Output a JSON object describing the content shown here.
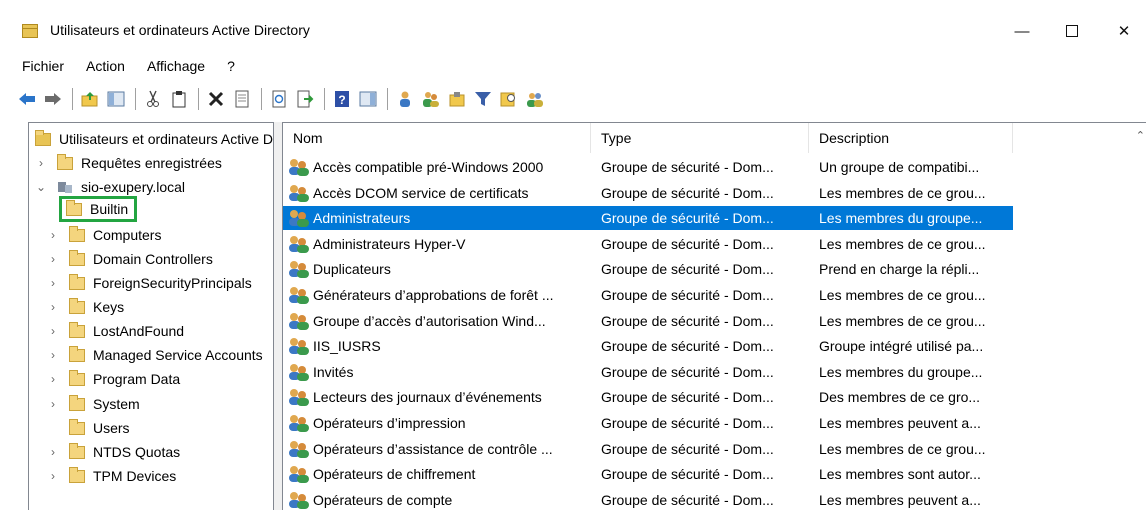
{
  "window": {
    "title": "Utilisateurs et ordinateurs Active Directory",
    "minimize_glyph": "—",
    "close_glyph": "✕"
  },
  "menu": [
    "Fichier",
    "Action",
    "Affichage",
    "?"
  ],
  "toolbar_icons": [
    "back-arrow-icon",
    "forward-arrow-icon",
    "up-folder-icon",
    "show-console-tree-icon",
    "cut-icon",
    "copy-icon",
    "delete-icon",
    "properties-icon",
    "refresh-icon",
    "export-list-icon",
    "help-icon",
    "show-hide-action-pane-icon",
    "new-user-icon",
    "new-group-icon",
    "new-ou-icon",
    "filter-icon",
    "find-icon",
    "add-to-group-icon"
  ],
  "tree": {
    "root": "Utilisateurs et ordinateurs Active Directory",
    "saved_queries": "Requêtes enregistrées",
    "domain": "sio-exupery.local",
    "children": [
      {
        "label": "Builtin",
        "expandable": false
      },
      {
        "label": "Computers",
        "expandable": true
      },
      {
        "label": "Domain Controllers",
        "expandable": true
      },
      {
        "label": "ForeignSecurityPrincipals",
        "expandable": true
      },
      {
        "label": "Keys",
        "expandable": true
      },
      {
        "label": "LostAndFound",
        "expandable": true
      },
      {
        "label": "Managed Service Accounts",
        "expandable": true
      },
      {
        "label": "Program Data",
        "expandable": true
      },
      {
        "label": "System",
        "expandable": true
      },
      {
        "label": "Users",
        "expandable": false
      },
      {
        "label": "NTDS Quotas",
        "expandable": true
      },
      {
        "label": "TPM Devices",
        "expandable": true
      }
    ]
  },
  "list": {
    "columns": [
      "Nom",
      "Type",
      "Description"
    ],
    "selected_index": 2,
    "rows": [
      {
        "name": "Accès compatible pré-Windows 2000",
        "type": "Groupe de sécurité - Dom...",
        "description": "Un groupe de compatibi..."
      },
      {
        "name": "Accès DCOM service de certificats",
        "type": "Groupe de sécurité - Dom...",
        "description": "Les membres de ce grou..."
      },
      {
        "name": "Administrateurs",
        "type": "Groupe de sécurité - Dom...",
        "description": "Les membres du groupe..."
      },
      {
        "name": "Administrateurs Hyper-V",
        "type": "Groupe de sécurité - Dom...",
        "description": "Les membres de ce grou..."
      },
      {
        "name": "Duplicateurs",
        "type": "Groupe de sécurité - Dom...",
        "description": "Prend en charge la répli..."
      },
      {
        "name": "Générateurs d’approbations de forêt ...",
        "type": "Groupe de sécurité - Dom...",
        "description": "Les membres de ce grou..."
      },
      {
        "name": "Groupe d’accès d’autorisation Wind...",
        "type": "Groupe de sécurité - Dom...",
        "description": "Les membres de ce grou..."
      },
      {
        "name": "IIS_IUSRS",
        "type": "Groupe de sécurité - Dom...",
        "description": "Groupe intégré utilisé pa..."
      },
      {
        "name": "Invités",
        "type": "Groupe de sécurité - Dom...",
        "description": "Les membres du groupe..."
      },
      {
        "name": "Lecteurs des journaux d’événements",
        "type": "Groupe de sécurité - Dom...",
        "description": "Des membres de ce gro..."
      },
      {
        "name": "Opérateurs d’impression",
        "type": "Groupe de sécurité - Dom...",
        "description": "Les membres peuvent a..."
      },
      {
        "name": "Opérateurs d’assistance de contrôle ...",
        "type": "Groupe de sécurité - Dom...",
        "description": "Les membres de ce grou..."
      },
      {
        "name": "Opérateurs de chiffrement",
        "type": "Groupe de sécurité - Dom...",
        "description": "Les membres sont autor..."
      },
      {
        "name": "Opérateurs de compte",
        "type": "Groupe de sécurité - Dom...",
        "description": "Les membres peuvent a..."
      }
    ]
  },
  "colors": {
    "selection": "#0078d7",
    "highlight_box": "#23a541",
    "folder": "#f4d57e"
  }
}
